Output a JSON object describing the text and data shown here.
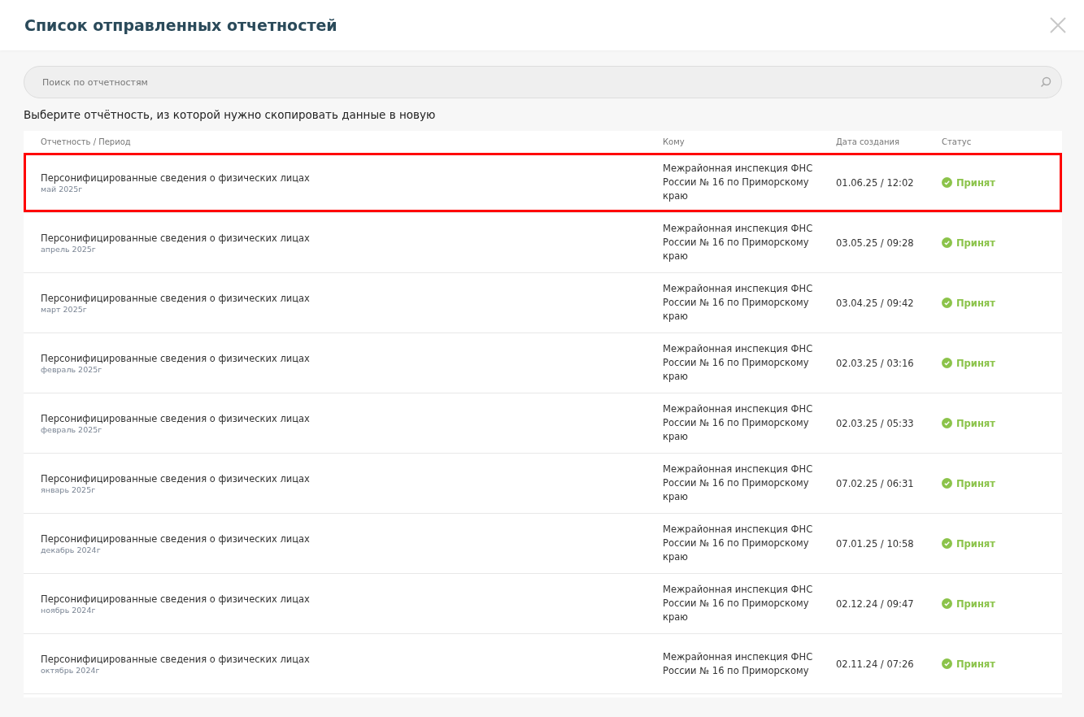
{
  "dialog": {
    "title": "Список отправленных отчетностей"
  },
  "search": {
    "placeholder": "Поиск по отчетностям"
  },
  "instruction": "Выберите отчётность, из которой нужно скопировать данные в новую",
  "table": {
    "columns": [
      "Отчетность / Период",
      "Кому",
      "Дата создания",
      "Статус"
    ],
    "rows": [
      {
        "report": "Персонифицированные сведения о физических лицах",
        "period": "май 2025г",
        "recipient": "Межрайонная инспекция ФНС России № 16 по Приморскому краю",
        "created": "01.06.25 / 12:02",
        "status": "Принят",
        "color": "#8bc34a",
        "selected": true
      },
      {
        "report": "Персонифицированные сведения о физических лицах",
        "period": "апрель 2025г",
        "recipient": "Межрайонная инспекция ФНС России № 16 по Приморскому краю",
        "created": "03.05.25 / 09:28",
        "status": "Принят",
        "color": "#8bc34a",
        "selected": false
      },
      {
        "report": "Персонифицированные сведения о физических лицах",
        "period": "март 2025г",
        "recipient": "Межрайонная инспекция ФНС России № 16 по Приморскому краю",
        "created": "03.04.25 / 09:42",
        "status": "Принят",
        "color": "#8bc34a",
        "selected": false
      },
      {
        "report": "Персонифицированные сведения о физических лицах",
        "period": "февраль 2025г",
        "recipient": "Межрайонная инспекция ФНС России № 16 по Приморскому краю",
        "created": "02.03.25 / 03:16",
        "status": "Принят",
        "color": "#8bc34a",
        "selected": false
      },
      {
        "report": "Персонифицированные сведения о физических лицах",
        "period": "февраль 2025г",
        "recipient": "Межрайонная инспекция ФНС России № 16 по Приморскому краю",
        "created": "02.03.25 / 05:33",
        "status": "Принят",
        "color": "#8bc34a",
        "selected": false
      },
      {
        "report": "Персонифицированные сведения о физических лицах",
        "period": "январь 2025г",
        "recipient": "Межрайонная инспекция ФНС России № 16 по Приморскому краю",
        "created": "07.02.25 / 06:31",
        "status": "Принят",
        "color": "#8bc34a",
        "selected": false
      },
      {
        "report": "Персонифицированные сведения о физических лицах",
        "period": "декабрь 2024г",
        "recipient": "Межрайонная инспекция ФНС России № 16 по Приморскому краю",
        "created": "07.01.25 / 10:58",
        "status": "Принят",
        "color": "#8bc34a",
        "selected": false
      },
      {
        "report": "Персонифицированные сведения о физических лицах",
        "period": "ноябрь 2024г",
        "recipient": "Межрайонная инспекция ФНС России № 16 по Приморскому краю",
        "created": "02.12.24 / 09:47",
        "status": "Принят",
        "color": "#8bc34a",
        "selected": false
      },
      {
        "report": "Персонифицированные сведения о физических лицах",
        "period": "октябрь 2024г",
        "recipient": "Межрайонная инспекция ФНС России № 16 по Приморскому",
        "created": "02.11.24 / 07:26",
        "status": "Принят",
        "color": "#8bc34a",
        "selected": false
      }
    ]
  }
}
